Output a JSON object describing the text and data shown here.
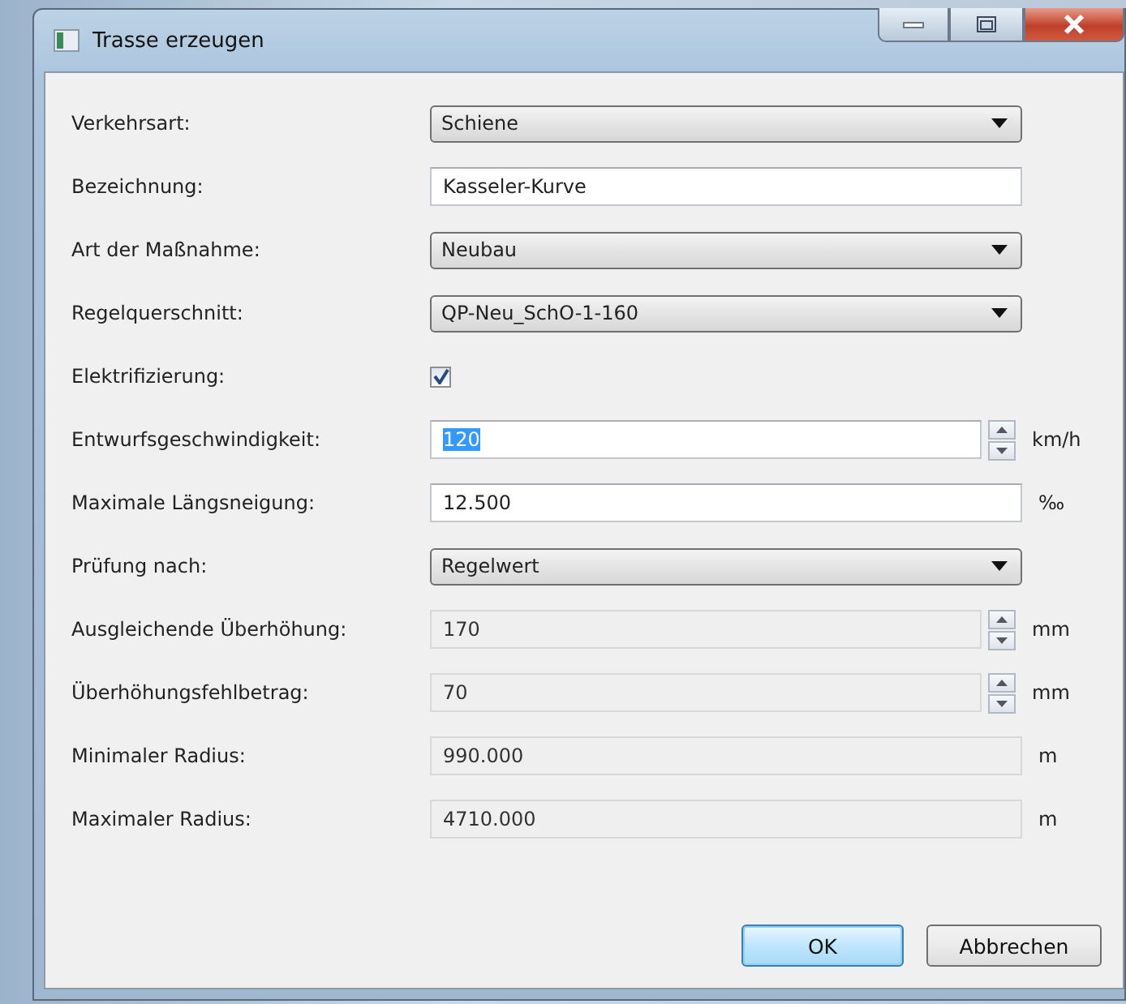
{
  "window": {
    "title": "Trasse erzeugen"
  },
  "fields": [
    {
      "label": "Verkehrsart:",
      "kind": "combo",
      "value": "Schiene"
    },
    {
      "label": "Bezeichnung:",
      "kind": "text",
      "value": "Kasseler-Kurve",
      "disabled": false
    },
    {
      "label": "Art der Maßnahme:",
      "kind": "combo",
      "value": "Neubau"
    },
    {
      "label": "Regelquerschnitt:",
      "kind": "combo",
      "value": "QP-Neu_SchO-1-160"
    },
    {
      "label": "Elektrifizierung:",
      "kind": "checkbox",
      "checked": true
    },
    {
      "label": "Entwurfsgeschwindigkeit:",
      "kind": "spin",
      "value": "120",
      "value_selected": true,
      "disabled": false,
      "unit": "km/h"
    },
    {
      "label": "Maximale Längsneigung:",
      "kind": "text",
      "value": "12.500",
      "disabled": false,
      "unit": "‰"
    },
    {
      "label": "Prüfung nach:",
      "kind": "combo",
      "value": "Regelwert"
    },
    {
      "label": "Ausgleichende Überhöhung:",
      "kind": "spin",
      "value": "170",
      "value_selected": false,
      "disabled": true,
      "unit": "mm"
    },
    {
      "label": "Überhöhungsfehlbetrag:",
      "kind": "spin",
      "value": "70",
      "value_selected": false,
      "disabled": true,
      "unit": "mm"
    },
    {
      "label": "Minimaler Radius:",
      "kind": "text",
      "value": "990.000",
      "disabled": true,
      "unit": "m"
    },
    {
      "label": "Maximaler Radius:",
      "kind": "text",
      "value": "4710.000",
      "disabled": true,
      "unit": "m"
    }
  ],
  "buttons": [
    {
      "label": "OK",
      "default": true
    },
    {
      "label": "Abbrechen",
      "default": false
    }
  ]
}
